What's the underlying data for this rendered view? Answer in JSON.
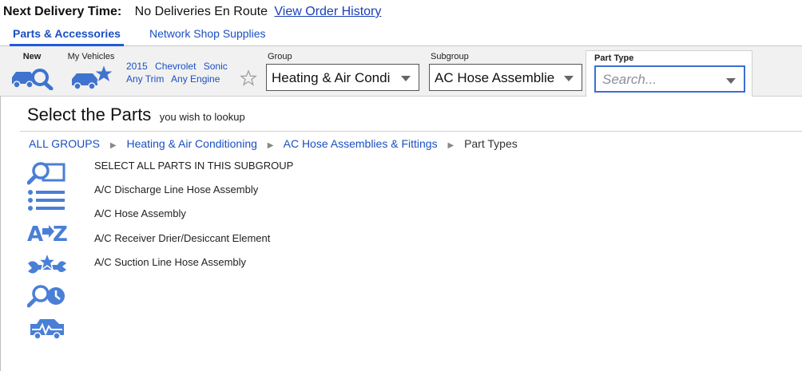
{
  "delivery": {
    "label": "Next Delivery Time:",
    "status": "No Deliveries En Route",
    "link": "View Order History"
  },
  "tabs": [
    {
      "label": "Parts & Accessories",
      "active": true
    },
    {
      "label": "Network Shop Supplies",
      "active": false
    }
  ],
  "toolbar": {
    "new_label": "New",
    "my_vehicles_label": "My Vehicles",
    "vehicle": {
      "year": "2015",
      "make": "Chevrolet",
      "model": "Sonic",
      "trim": "Any Trim",
      "engine": "Any Engine"
    },
    "group": {
      "label": "Group",
      "value": "Heating & Air Condi"
    },
    "subgroup": {
      "label": "Subgroup",
      "value": "AC Hose Assemblie"
    },
    "part_type": {
      "label": "Part Type",
      "placeholder": "Search..."
    }
  },
  "main": {
    "title": "Select the Parts",
    "subtitle": "you wish to lookup",
    "breadcrumb": {
      "items": [
        "ALL GROUPS",
        "Heating & Air Conditioning",
        "AC Hose Assemblies & Fittings"
      ],
      "current": "Part Types"
    },
    "parts": [
      "SELECT ALL PARTS IN THIS SUBGROUP",
      "A/C Discharge Line Hose Assembly",
      "A/C Hose Assembly",
      "A/C Receiver Drier/Desiccant Element",
      "A/C Suction Line Hose Assembly"
    ],
    "view_icons": [
      "search-lookup-icon",
      "list-view-icon",
      "a-to-z-icon",
      "favorite-tools-icon",
      "search-history-icon",
      "diagnostics-icon"
    ]
  },
  "colors": {
    "accent": "#1a4fc2",
    "icon": "#4a7fd6",
    "toolbar_bg": "#f1f1f1"
  }
}
